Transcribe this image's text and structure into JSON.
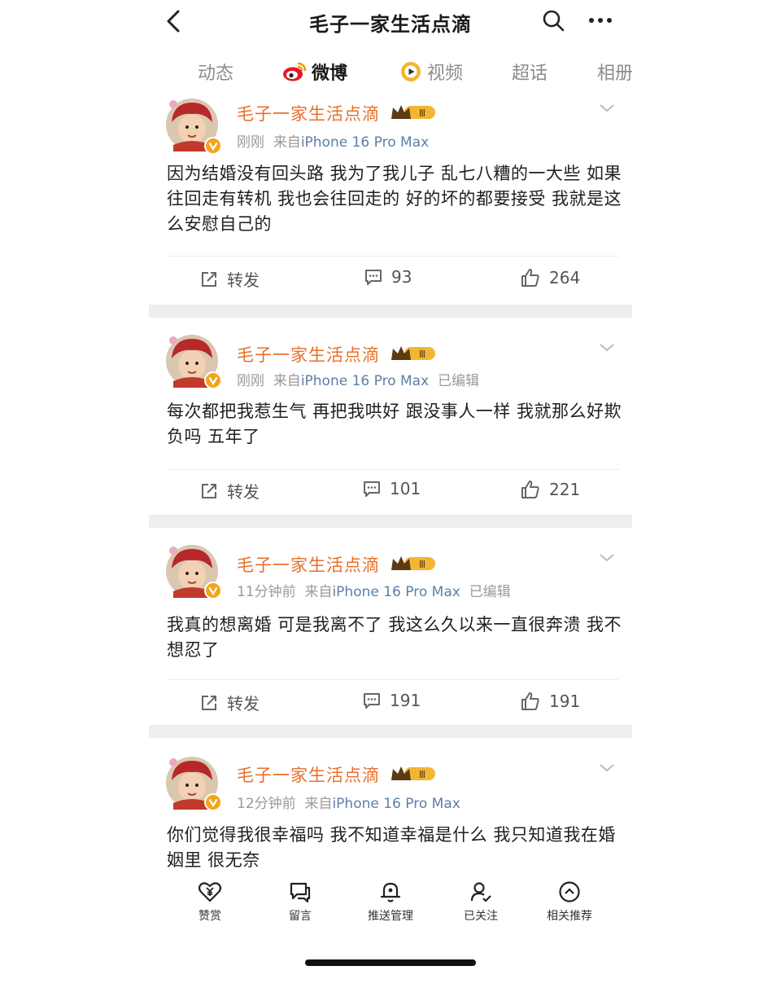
{
  "header": {
    "title": "毛子一家生活点滴",
    "back_icon": "chevron-left-icon",
    "search_icon": "search-icon",
    "more_icon": "more-horizontal-icon"
  },
  "tabs": [
    {
      "label": "动态",
      "active": false
    },
    {
      "label": "微博",
      "active": true,
      "icon": "weibo-logo-icon"
    },
    {
      "label": "视频",
      "active": false,
      "icon": "video-icon"
    },
    {
      "label": "超话",
      "active": false
    },
    {
      "label": "相册",
      "active": false
    }
  ],
  "posts": [
    {
      "username": "毛子一家生活点滴",
      "badge": "Ⅲ",
      "time": "刚刚",
      "source_prefix": "来自",
      "source": "iPhone 16 Pro Max",
      "edited": "",
      "text": "因为结婚没有回头路 我为了我儿子 乱七八糟的一大些 如果往回走有转机 我也会往回走的 好的坏的都要接受 我就是这么安慰自己的",
      "repost_label": "转发",
      "comments": "93",
      "likes": "264"
    },
    {
      "username": "毛子一家生活点滴",
      "badge": "Ⅲ",
      "time": "刚刚",
      "source_prefix": "来自",
      "source": "iPhone 16 Pro Max",
      "edited": "已编辑",
      "text": "每次都把我惹生气 再把我哄好 跟没事人一样 我就那么好欺负吗 五年了",
      "repost_label": "转发",
      "comments": "101",
      "likes": "221"
    },
    {
      "username": "毛子一家生活点滴",
      "badge": "Ⅲ",
      "time": "11分钟前",
      "source_prefix": "来自",
      "source": "iPhone 16 Pro Max",
      "edited": "已编辑",
      "text": "我真的想离婚 可是我离不了 我这么久以来一直很奔溃 我不想忍了",
      "repost_label": "转发",
      "comments": "191",
      "likes": "191"
    },
    {
      "username": "毛子一家生活点滴",
      "badge": "Ⅲ",
      "time": "12分钟前",
      "source_prefix": "来自",
      "source": "iPhone 16 Pro Max",
      "edited": "",
      "text": "你们觉得我很幸福吗 我不知道幸福是什么 我只知道我在婚姻里 很无奈",
      "repost_label": "",
      "comments": "",
      "likes": ""
    }
  ],
  "bottom_bar": [
    {
      "label": "赞赏",
      "icon": "heart-yen-icon"
    },
    {
      "label": "留言",
      "icon": "message-icon"
    },
    {
      "label": "推送管理",
      "icon": "bell-icon"
    },
    {
      "label": "已关注",
      "icon": "user-check-icon"
    },
    {
      "label": "相关推荐",
      "icon": "chevron-up-circle-icon"
    }
  ],
  "colors": {
    "username": "#e8702a",
    "source": "#5b7fa8",
    "gray": "#9a9a9a",
    "weibo_red": "#e6162d",
    "badge_gold": "#f2b632"
  }
}
